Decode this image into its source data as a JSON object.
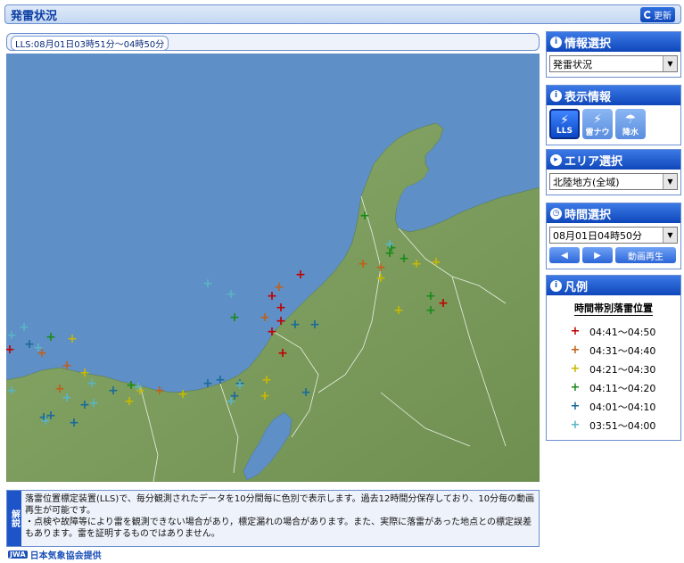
{
  "header": {
    "title": "発雷状況",
    "refresh_label": "更新"
  },
  "time_range": "LLS:08月01日03時51分～04時50分",
  "panels": {
    "info_select": {
      "title": "情報選択",
      "value": "発雷状況"
    },
    "display_info": {
      "title": "表示情報",
      "buttons": [
        {
          "label": "LLS",
          "icon": "lightning-plus-icon"
        },
        {
          "label": "雷ナウ",
          "icon": "lightning-nowcast-icon"
        },
        {
          "label": "降水",
          "icon": "umbrella-icon"
        }
      ]
    },
    "area_select": {
      "title": "エリア選択",
      "value": "北陸地方(全域)"
    },
    "time_select": {
      "title": "時間選択",
      "value": "08月01日04時50分",
      "prev_label": "◀",
      "next_label": "▶",
      "play_label": "動画再生"
    },
    "legend": {
      "title": "凡例",
      "subtitle": "時間帯別落雷位置",
      "items": [
        {
          "label": "04:41～04:50",
          "color": "#c00000"
        },
        {
          "label": "04:31～04:40",
          "color": "#c0601a"
        },
        {
          "label": "04:21～04:30",
          "color": "#c8b800"
        },
        {
          "label": "04:11～04:20",
          "color": "#1a8a1a"
        },
        {
          "label": "04:01～04:10",
          "color": "#1a6a9a"
        },
        {
          "label": "03:51～04:00",
          "color": "#5ab4c4"
        }
      ]
    }
  },
  "note": {
    "tag": "解説",
    "text_1": "落雷位置標定装置(LLS)で、毎分観測されたデータを10分間毎に色別で表示します。過去12時間分保存しており、10分毎の動画再生が可能です。",
    "text_2": "・点検や故障等により雷を観測できない場合があり，標定漏れの場合があります。また、実際に落雷があった地点との標定誤差もあります。雷を証明するものではありません。"
  },
  "footer": {
    "logo": "JWA",
    "text": "日本気象協会提供"
  },
  "colors": {
    "accent": "#1d55c8",
    "sea": "#5e8fc6",
    "land": "#7a9a5c"
  }
}
